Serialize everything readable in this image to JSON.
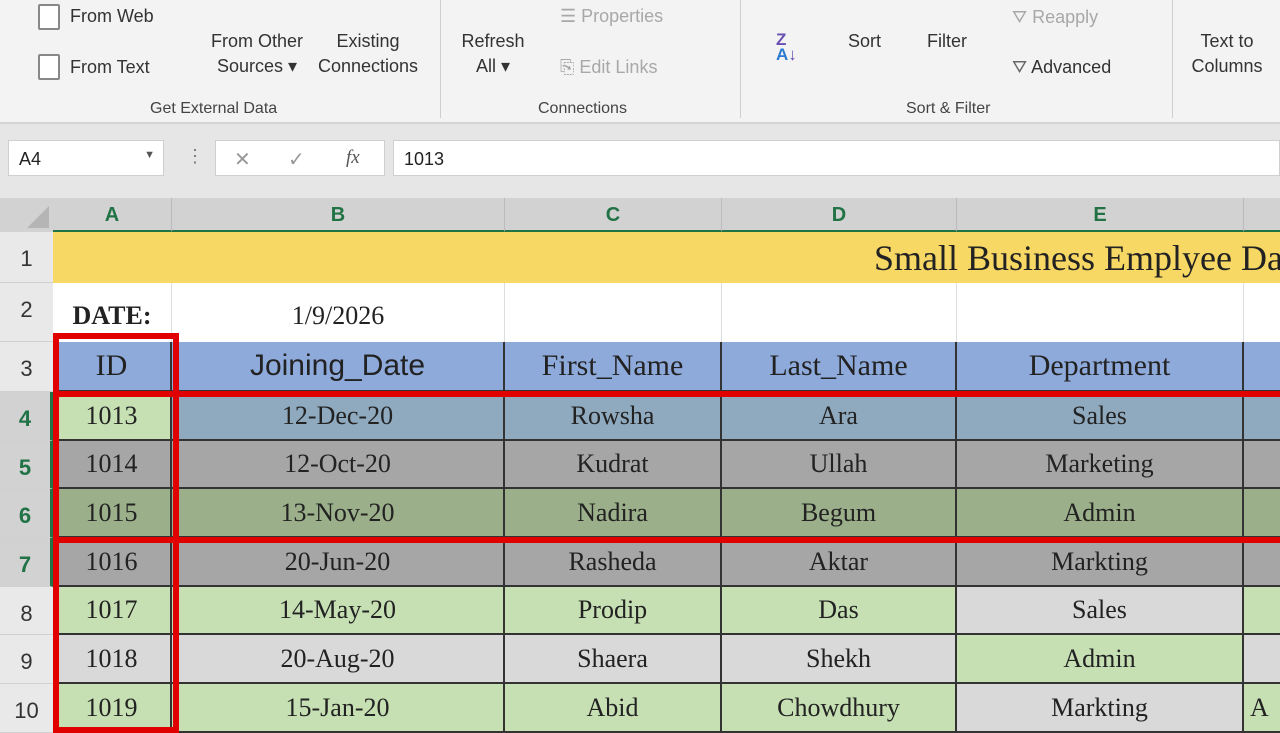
{
  "ribbon": {
    "from_web": "From Web",
    "from_text": "From Text",
    "from_other_1": "From Other",
    "from_other_2": "Sources ▾",
    "existing_1": "Existing",
    "existing_2": "Connections",
    "group_external": "Get External Data",
    "refresh_1": "Refresh",
    "refresh_2": "All ▾",
    "properties": "Properties",
    "edit_links": "Edit Links",
    "group_connections": "Connections",
    "sort": "Sort",
    "filter": "Filter",
    "reapply": "Reapply",
    "advanced": "Advanced",
    "group_sort": "Sort & Filter",
    "text_to_1": "Text to",
    "text_to_2": "Columns"
  },
  "formula_bar": {
    "name_box": "A4",
    "value": "1013",
    "fx": "fx"
  },
  "columns": [
    "A",
    "B",
    "C",
    "D",
    "E"
  ],
  "rows": [
    "1",
    "2",
    "3",
    "4",
    "5",
    "6",
    "7",
    "8",
    "9",
    "10"
  ],
  "sheet": {
    "title": "Small Business Emplyee Dat",
    "date_label": "DATE:",
    "date_value": "1/9/2026",
    "headers": [
      "ID",
      "Joining_Date",
      "First_Name",
      "Last_Name",
      "Department"
    ],
    "data": [
      [
        "1013",
        "12-Dec-20",
        "Rowsha",
        "Ara",
        "Sales"
      ],
      [
        "1014",
        "12-Oct-20",
        "Kudrat",
        "Ullah",
        "Marketing"
      ],
      [
        "1015",
        "13-Nov-20",
        "Nadira",
        "Begum",
        "Admin"
      ],
      [
        "1016",
        "20-Jun-20",
        "Rasheda",
        "Aktar",
        "Markting"
      ],
      [
        "1017",
        "14-May-20",
        "Prodip",
        "Das",
        "Sales"
      ],
      [
        "1018",
        "20-Aug-20",
        "Shaera",
        "Shekh",
        "Admin"
      ],
      [
        "1019",
        "15-Jan-20",
        "Abid",
        "Chowdhury",
        "Markting"
      ]
    ],
    "col_f_row10": "A"
  },
  "colors": {
    "title_fill": "#f8d865",
    "header_fill": "#8eaadb",
    "highlight": "#e10000"
  }
}
